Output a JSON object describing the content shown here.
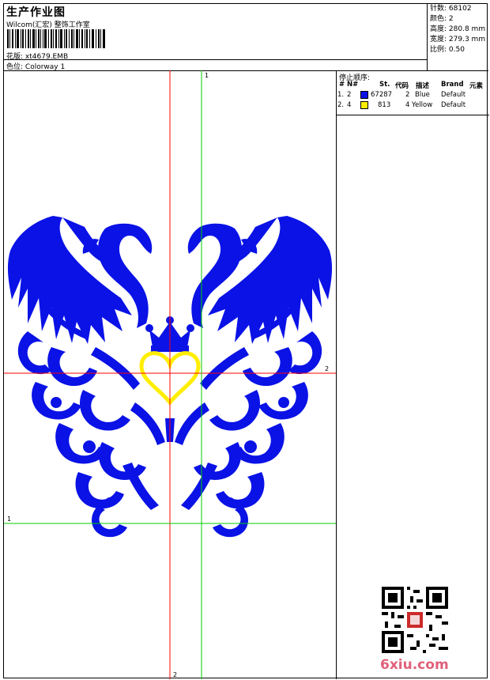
{
  "header": {
    "title": "生产作业图",
    "studio": "Wilcom(汇宏) 整饰工作室",
    "pattern_label": "花版:",
    "pattern_value": "xt4679.EMB",
    "color_label": "色位:",
    "color_value": "Colorway 1"
  },
  "stats": {
    "stitches_label": "针数:",
    "stitches_value": "68102",
    "colors_label": "颜色:",
    "colors_value": "2",
    "height_label": "高度:",
    "height_value": "280.8 mm",
    "width_label": "宽度:",
    "width_value": "279.3 mm",
    "scale_label": "比例:",
    "scale_value": "0.50"
  },
  "stop_sequence": {
    "title": "停止顺序:",
    "headers": [
      "#",
      "N#",
      "St.",
      "代码",
      "描述",
      "Brand",
      "元素"
    ],
    "rows": [
      {
        "index": "1.",
        "needle": "2",
        "color": "#0a12e6",
        "stitches": "67287",
        "code": "2",
        "desc": "Blue",
        "brand": "Default"
      },
      {
        "index": "2.",
        "needle": "4",
        "color": "#ffee00",
        "stitches": "813",
        "code": "4",
        "desc": "Yellow",
        "brand": "Default"
      }
    ]
  },
  "axes": {
    "green_label": "1",
    "red_label": "2"
  },
  "design_colors": {
    "primary": "#0a12e6",
    "secondary": "#ffee00",
    "red_axis": "#ff0000",
    "green_axis": "#00cc00"
  },
  "watermark": "6xiu.com"
}
